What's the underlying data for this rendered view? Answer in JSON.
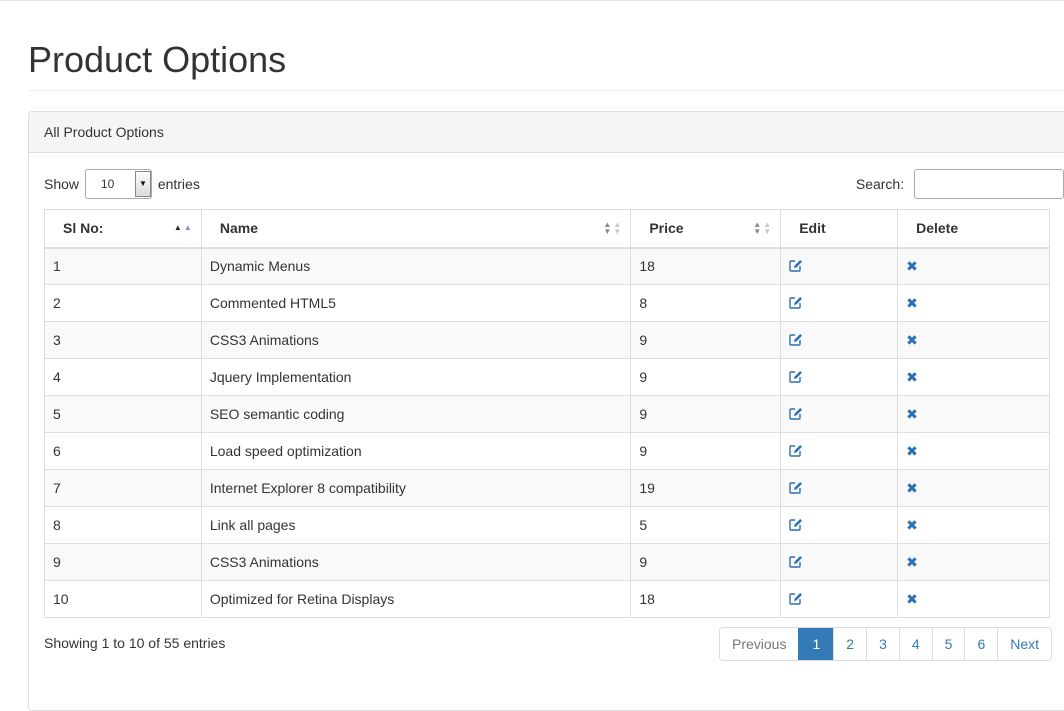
{
  "page_title": "Product Options",
  "panel": {
    "heading": "All Product Options"
  },
  "length": {
    "show_label": "Show",
    "selected": "10",
    "entries_label": "entries"
  },
  "search": {
    "label": "Search:",
    "value": "",
    "placeholder": ""
  },
  "table": {
    "columns": [
      "Sl No:",
      "Name",
      "Price",
      "Edit",
      "Delete"
    ],
    "rows": [
      {
        "no": "1",
        "name": "Dynamic Menus",
        "price": "18"
      },
      {
        "no": "2",
        "name": "Commented HTML5",
        "price": "8"
      },
      {
        "no": "3",
        "name": "CSS3 Animations",
        "price": "9"
      },
      {
        "no": "4",
        "name": "Jquery Implementation",
        "price": "9"
      },
      {
        "no": "5",
        "name": "SEO semantic coding",
        "price": "9"
      },
      {
        "no": "6",
        "name": "Load speed optimization",
        "price": "9"
      },
      {
        "no": "7",
        "name": "Internet Explorer 8 compatibility",
        "price": "19"
      },
      {
        "no": "8",
        "name": "Link all pages",
        "price": "5"
      },
      {
        "no": "9",
        "name": "CSS3 Animations",
        "price": "9"
      },
      {
        "no": "10",
        "name": "Optimized for Retina Displays",
        "price": "18"
      }
    ],
    "edit_icon": "edit-icon",
    "delete_icon": "close-icon",
    "sort": {
      "column": "Sl No:",
      "direction": "ascending"
    }
  },
  "info": "Showing 1 to 10 of 55 entries",
  "pagination": {
    "previous": "Previous",
    "next": "Next",
    "pages": [
      "1",
      "2",
      "3",
      "4",
      "5",
      "6"
    ],
    "current": "1"
  },
  "colors": {
    "accent": "#337ab7",
    "icon": "#2a6fb8",
    "stripe": "#f9f9f9",
    "border": "#dddddd"
  }
}
